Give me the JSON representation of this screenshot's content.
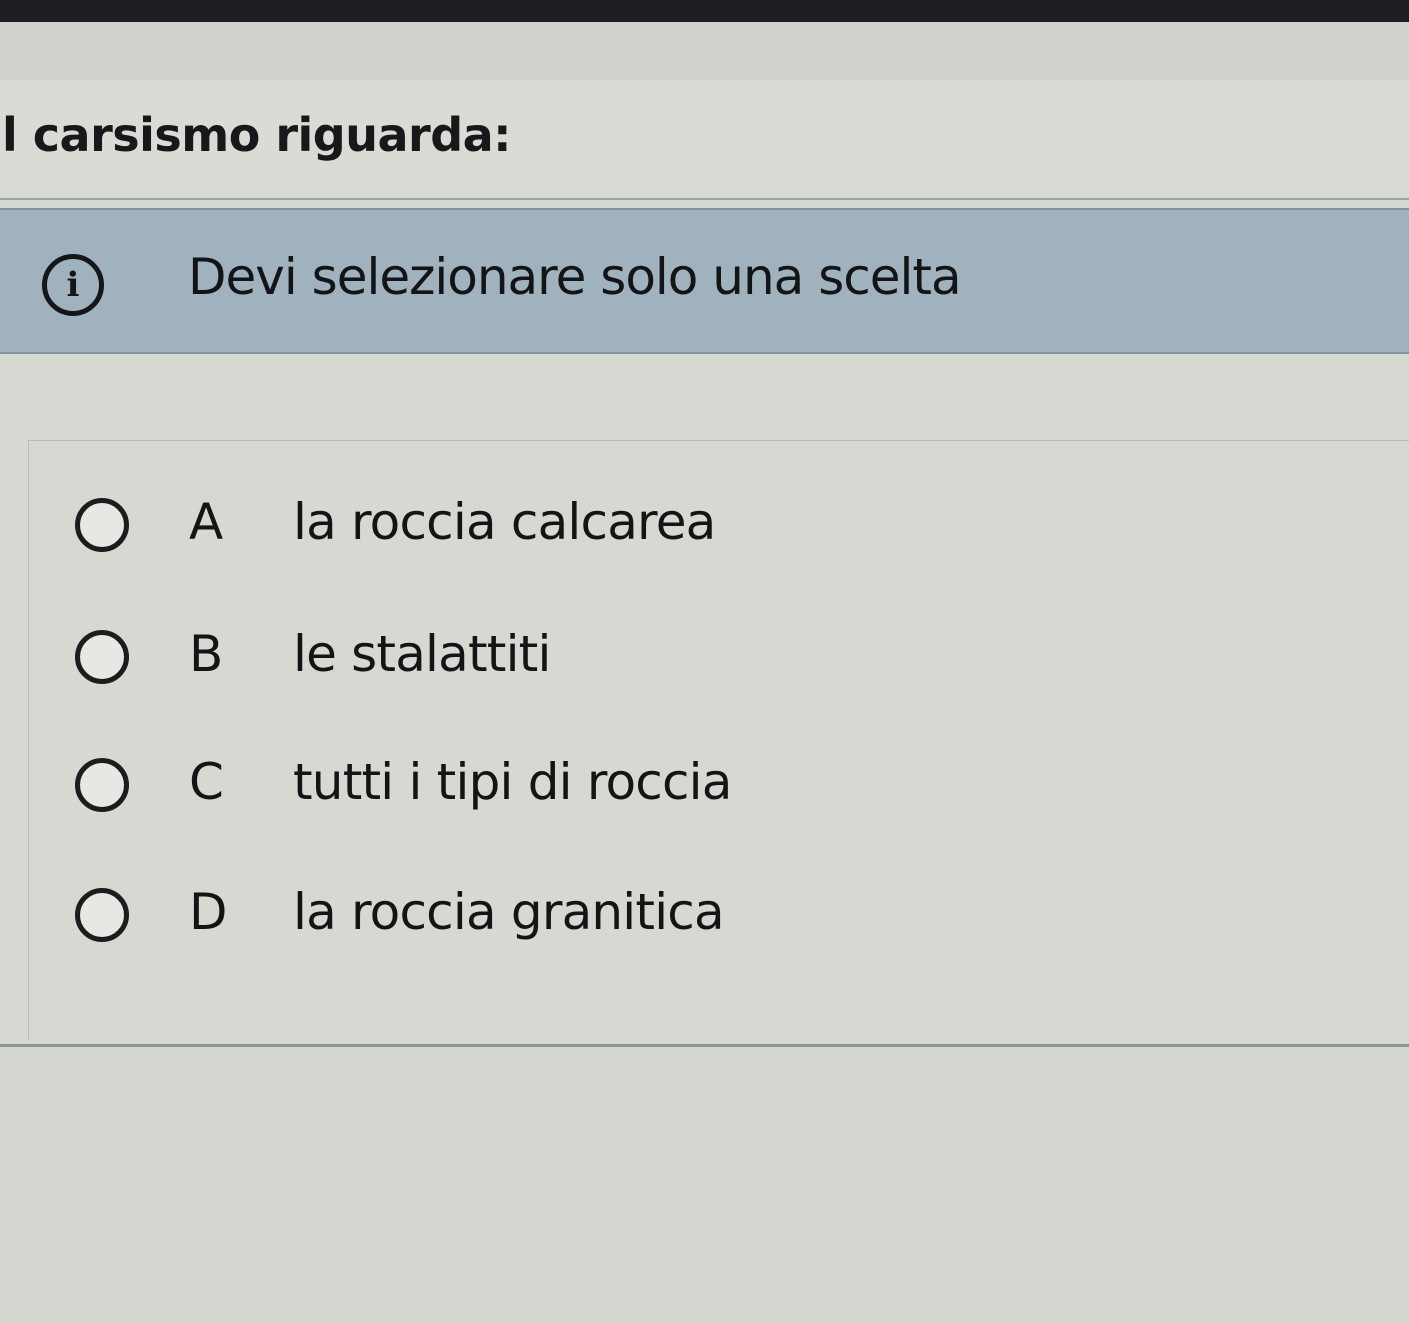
{
  "question": {
    "title": "l carsismo riguarda:"
  },
  "info_banner": {
    "icon": "info-icon",
    "icon_glyph": "i",
    "message": "Devi selezionare solo una scelta"
  },
  "options": [
    {
      "letter": "A",
      "text": "la roccia calcarea",
      "selected": false
    },
    {
      "letter": "B",
      "text": "le stalattiti",
      "selected": false
    },
    {
      "letter": "C",
      "text": "tutti i tipi di roccia",
      "selected": false
    },
    {
      "letter": "D",
      "text": "la roccia granitica",
      "selected": false
    }
  ],
  "colors": {
    "banner_background": "#9fb2bd",
    "page_background": "#d6d8d2",
    "text": "#121415"
  }
}
